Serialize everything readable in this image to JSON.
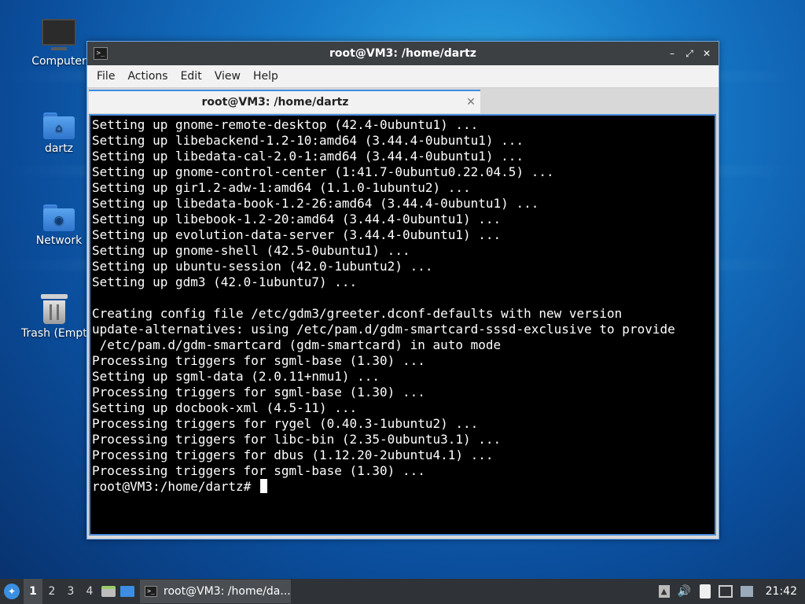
{
  "desktop": {
    "icons": [
      {
        "label": "Computer"
      },
      {
        "label": "dartz"
      },
      {
        "label": "Network"
      },
      {
        "label": "Trash (Empty)"
      }
    ]
  },
  "window": {
    "title": "root@VM3: /home/dartz",
    "menu": [
      "File",
      "Actions",
      "Edit",
      "View",
      "Help"
    ],
    "tab_label": "root@VM3: /home/dartz",
    "controls": {
      "minimize": "–",
      "maximize": "⤢",
      "close": "✕"
    }
  },
  "terminal": {
    "lines": [
      "Setting up gnome-remote-desktop (42.4-0ubuntu1) ...",
      "Setting up libebackend-1.2-10:amd64 (3.44.4-0ubuntu1) ...",
      "Setting up libedata-cal-2.0-1:amd64 (3.44.4-0ubuntu1) ...",
      "Setting up gnome-control-center (1:41.7-0ubuntu0.22.04.5) ...",
      "Setting up gir1.2-adw-1:amd64 (1.1.0-1ubuntu2) ...",
      "Setting up libedata-book-1.2-26:amd64 (3.44.4-0ubuntu1) ...",
      "Setting up libebook-1.2-20:amd64 (3.44.4-0ubuntu1) ...",
      "Setting up evolution-data-server (3.44.4-0ubuntu1) ...",
      "Setting up gnome-shell (42.5-0ubuntu1) ...",
      "Setting up ubuntu-session (42.0-1ubuntu2) ...",
      "Setting up gdm3 (42.0-1ubuntu7) ...",
      "",
      "Creating config file /etc/gdm3/greeter.dconf-defaults with new version",
      "update-alternatives: using /etc/pam.d/gdm-smartcard-sssd-exclusive to provide",
      " /etc/pam.d/gdm-smartcard (gdm-smartcard) in auto mode",
      "Processing triggers for sgml-base (1.30) ...",
      "Setting up sgml-data (2.0.11+nmu1) ...",
      "Processing triggers for sgml-base (1.30) ...",
      "Setting up docbook-xml (4.5-11) ...",
      "Processing triggers for rygel (0.40.3-1ubuntu2) ...",
      "Processing triggers for libc-bin (2.35-0ubuntu3.1) ...",
      "Processing triggers for dbus (1.12.20-2ubuntu4.1) ...",
      "Processing triggers for sgml-base (1.30) ..."
    ],
    "prompt": "root@VM3:/home/dartz# "
  },
  "taskbar": {
    "workspaces": [
      "1",
      "2",
      "3",
      "4"
    ],
    "active_workspace": "1",
    "task_label": "root@VM3: /home/da...",
    "clock": "21:42"
  },
  "colors": {
    "accent": "#3d8ee2",
    "terminal_bg": "#000000",
    "taskbar_bg": "#2f3236"
  }
}
